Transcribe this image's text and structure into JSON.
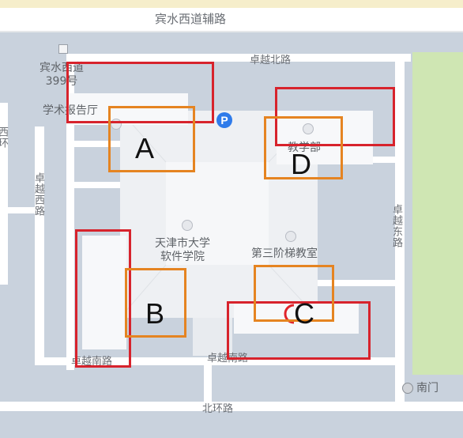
{
  "map": {
    "roads": {
      "north_main": "宾水西道辅路",
      "north_inner": "卓越北路",
      "west": "卓越西路",
      "east": "卓越东路",
      "south_inner": "卓越南路",
      "south_outer": "北环路",
      "far_west_partial": "西环"
    },
    "pois": {
      "address_line1": "宾水西道",
      "address_line2": "399号",
      "lecture_hall": "学术报告厅",
      "teaching_dept": "教学部",
      "college_line1": "天津市大学",
      "college_line2": "软件学院",
      "classroom": "第三阶梯教室",
      "south_gate": "南门"
    },
    "markers": [
      "A",
      "B",
      "C",
      "D"
    ],
    "icons": [
      "parking-icon",
      "school-icon",
      "building-icon",
      "gate-icon",
      "address-icon"
    ],
    "colors": {
      "red_box": "#d7232c",
      "orange_box": "#e58421",
      "water": "#c9d2dd",
      "park": "#cfe6b3",
      "road": "#ffffff",
      "parking": "#2f7bea"
    }
  }
}
